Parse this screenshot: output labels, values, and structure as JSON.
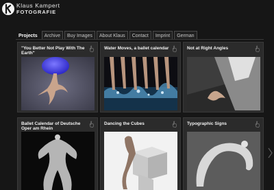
{
  "site": {
    "name_line1": "Klaus Kampert",
    "name_line2": "FOTOGRAFIE"
  },
  "nav": {
    "tabs": [
      {
        "label": "Projects",
        "active": true
      },
      {
        "label": "Archive"
      },
      {
        "label": "Buy Images"
      },
      {
        "label": "About Klaus"
      },
      {
        "label": "Contact"
      },
      {
        "label": "Imprint"
      },
      {
        "label": "German"
      }
    ]
  },
  "projects": [
    {
      "title": "\"You Better Not Play With The Earth\"",
      "image": "dancer-with-blue-globe"
    },
    {
      "title": "Water Moves, a ballet calendar",
      "image": "dancers-legs-in-water"
    },
    {
      "title": "Not at Right Angles",
      "image": "figure-in-light-corner"
    },
    {
      "title": "Ballet Calendar of Deutsche Oper am Rhein",
      "image": "symmetric-dancers"
    },
    {
      "title": "Dancing the Cubes",
      "image": "dancer-on-cubes"
    },
    {
      "title": "Typographic Signs",
      "image": "curved-figure"
    }
  ],
  "icons": {
    "card_corner": "hand-pointer-icon",
    "next": "chevron-right-icon"
  },
  "colors": {
    "background": "#161616",
    "card": "#2b2b2b",
    "globe_blue": "#3a36e8"
  }
}
